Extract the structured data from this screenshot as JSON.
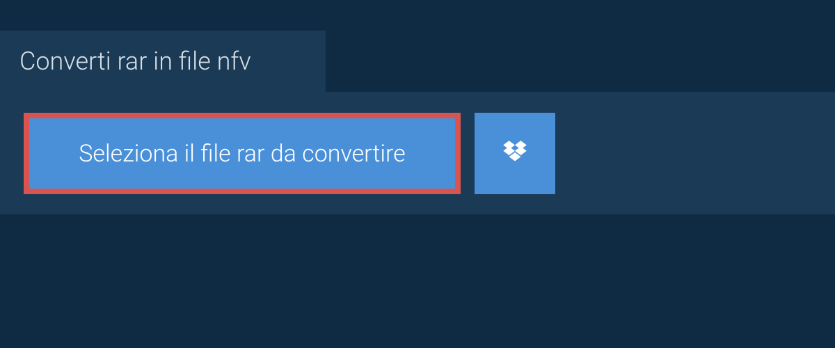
{
  "title": "Converti rar in file nfv",
  "select_button": "Seleziona il file rar da convertire"
}
